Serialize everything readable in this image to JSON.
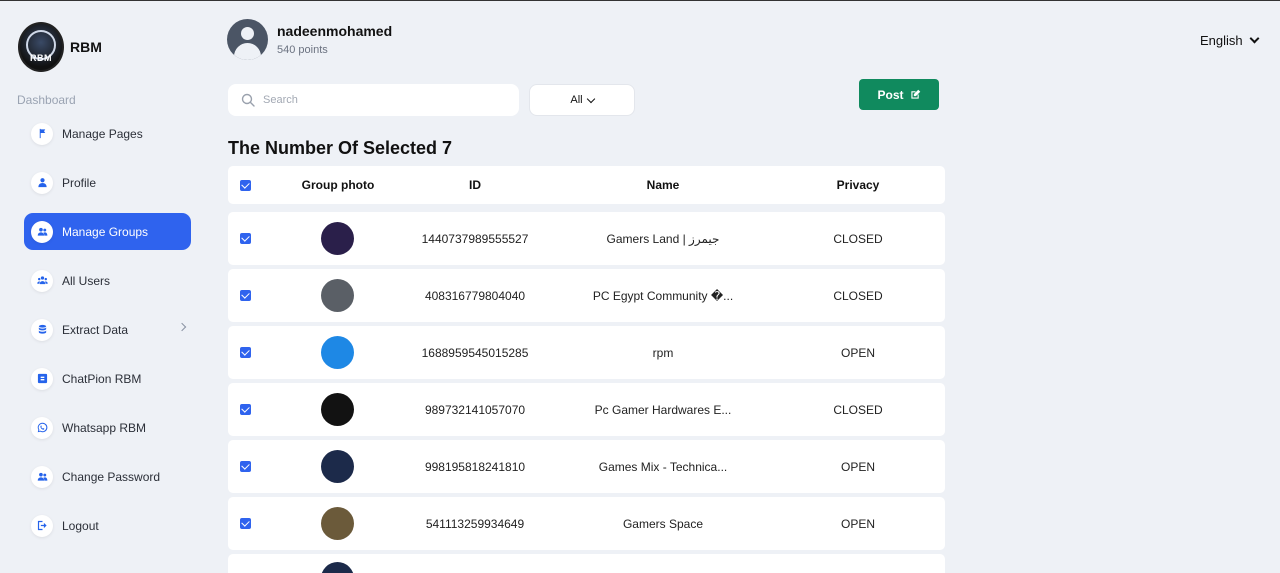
{
  "brand": {
    "logo_text": "RBM",
    "name": "RBM"
  },
  "sidebar": {
    "section_label": "Dashboard",
    "items": [
      {
        "label": "Manage Pages",
        "icon": "flag-icon",
        "active": false
      },
      {
        "label": "Profile",
        "icon": "user-icon",
        "active": false
      },
      {
        "label": "Manage Groups",
        "icon": "users-icon",
        "active": true
      },
      {
        "label": "All Users",
        "icon": "user-group-icon",
        "active": false
      },
      {
        "label": "Extract Data",
        "icon": "database-icon",
        "active": false,
        "has_submenu": true
      },
      {
        "label": "ChatPion RBM",
        "icon": "chat-icon",
        "active": false
      },
      {
        "label": "Whatsapp RBM",
        "icon": "whatsapp-icon",
        "active": false
      },
      {
        "label": "Change Password",
        "icon": "users-icon",
        "active": false
      },
      {
        "label": "Logout",
        "icon": "logout-icon",
        "active": false
      }
    ]
  },
  "header": {
    "username": "nadeenmohamed",
    "points": "540 points",
    "language": "English"
  },
  "toolbar": {
    "search_placeholder": "Search",
    "filter_value": "All",
    "post_label": "Post"
  },
  "selected_title": "The Number Of Selected 7",
  "table": {
    "columns": [
      "Group photo",
      "ID",
      "Name",
      "Privacy"
    ],
    "rows": [
      {
        "id": "1440737989555527",
        "name": "Gamers Land | جيمرز",
        "privacy": "CLOSED",
        "photo_color": "#2a1f4a"
      },
      {
        "id": "408316779804040",
        "name": "PC Egypt Community �...",
        "privacy": "CLOSED",
        "photo_color": "#5a5f66"
      },
      {
        "id": "1688959545015285",
        "name": "rpm",
        "privacy": "OPEN",
        "photo_color": "#1e88e5"
      },
      {
        "id": "989732141057070",
        "name": "Pc Gamer Hardwares E...",
        "privacy": "CLOSED",
        "photo_color": "#121212"
      },
      {
        "id": "998195818241810",
        "name": "Games Mix - Technica...",
        "privacy": "OPEN",
        "photo_color": "#1c2a4a"
      },
      {
        "id": "541113259934649",
        "name": "Gamers Space",
        "privacy": "OPEN",
        "photo_color": "#6b5a3a"
      }
    ]
  },
  "colors": {
    "accent": "#2f63ee",
    "post_button": "#108a5e",
    "background": "#eef1f6"
  }
}
